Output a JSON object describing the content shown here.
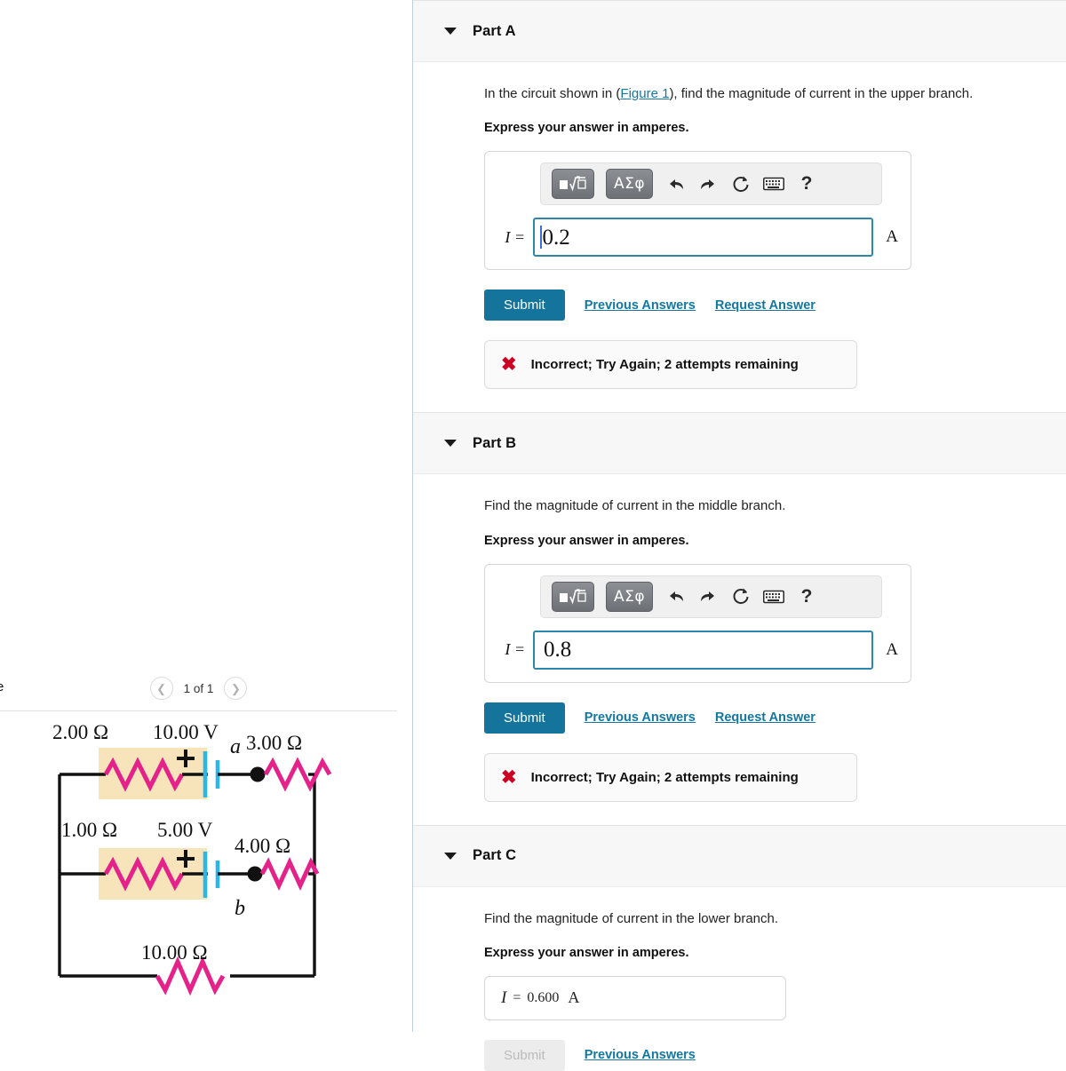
{
  "figure_panel": {
    "cut_glyph": "e",
    "pager": {
      "prev_icon": "chevron-left-icon",
      "label": "1 of 1",
      "next_icon": "chevron-right-icon"
    },
    "circuit": {
      "labels": {
        "r_top_left": "2.00 Ω",
        "emf_top": "10.00 V",
        "node_a": "a",
        "r_top_right": "3.00 Ω",
        "r_mid_left": "1.00 Ω",
        "emf_mid": "5.00 V",
        "r_mid_right": "4.00 Ω",
        "node_b": "b",
        "r_bottom": "10.00 Ω",
        "plus_top": "+",
        "plus_mid": "+"
      },
      "colors": {
        "resistor": "#e5218a",
        "battery_plate": "#2bb5e8",
        "highlight": "#f7e4bb",
        "wire": "#111111"
      }
    }
  },
  "parts": [
    {
      "id": "part-a",
      "title": "Part A",
      "caret_icon": "caret-down-icon",
      "prompt_before": "In the circuit shown in (",
      "prompt_link": "Figure 1",
      "prompt_after": "), find the magnitude of current in the upper branch.",
      "express": "Express your answer in amperes.",
      "toolbar": {
        "template_btn": "□√□",
        "greek_btn": "ΑΣφ",
        "undo_icon": "undo-icon",
        "redo_icon": "redo-icon",
        "reset_icon": "reset-icon",
        "keyboard_icon": "keyboard-icon",
        "help_icon": "help-icon"
      },
      "answer": {
        "label": "I =",
        "value": "0.2",
        "unit": "A"
      },
      "submit_label": "Submit",
      "previous_answers_label": "Previous Answers",
      "request_answer_label": "Request Answer",
      "feedback": {
        "icon": "x-mark-icon",
        "text": "Incorrect; Try Again; 2 attempts remaining"
      }
    },
    {
      "id": "part-b",
      "title": "Part B",
      "caret_icon": "caret-down-icon",
      "prompt_before": "Find the magnitude of current in the middle branch.",
      "prompt_link": "",
      "prompt_after": "",
      "express": "Express your answer in amperes.",
      "toolbar": {
        "template_btn": "□√□",
        "greek_btn": "ΑΣφ",
        "undo_icon": "undo-icon",
        "redo_icon": "redo-icon",
        "reset_icon": "reset-icon",
        "keyboard_icon": "keyboard-icon",
        "help_icon": "help-icon"
      },
      "answer": {
        "label": "I =",
        "value": "0.8",
        "unit": "A"
      },
      "submit_label": "Submit",
      "previous_answers_label": "Previous Answers",
      "request_answer_label": "Request Answer",
      "feedback": {
        "icon": "x-mark-icon",
        "text": "Incorrect; Try Again; 2 attempts remaining"
      }
    },
    {
      "id": "part-c",
      "title": "Part C",
      "caret_icon": "caret-down-icon",
      "prompt_before": "Find the magnitude of current in the lower branch.",
      "express": "Express your answer in amperes.",
      "answer": {
        "label": "I",
        "equals": "=",
        "value": "0.600",
        "unit": "A"
      },
      "submit_label": "Submit",
      "previous_answers_label": "Previous Answers"
    }
  ]
}
